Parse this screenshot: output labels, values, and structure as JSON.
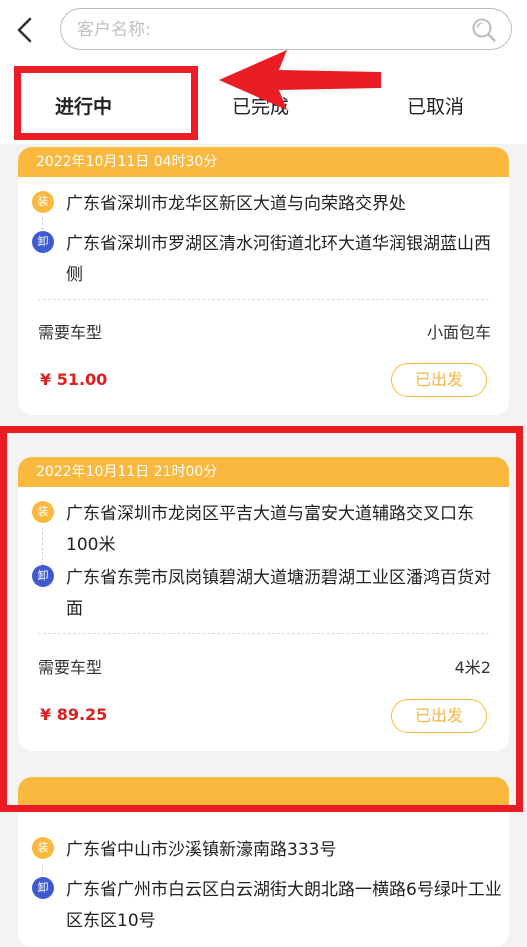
{
  "search": {
    "placeholder": "客户名称:"
  },
  "tabs": [
    {
      "label": "进行中"
    },
    {
      "label": "已完成"
    },
    {
      "label": "已取消"
    }
  ],
  "orders": [
    {
      "datetime": "2022年10月11日  04时30分",
      "load_badge": "装",
      "load_address": "广东省深圳市龙华区新区大道与向荣路交界处",
      "unload_badge": "卸",
      "unload_address": "广东省深圳市罗湖区清水河街道北环大道华润银湖蓝山西侧",
      "vehicle_label": "需要车型",
      "vehicle_type": "小面包车",
      "price": "¥ 51.00",
      "status": "已出发"
    },
    {
      "datetime": "2022年10月11日  21时00分",
      "load_badge": "装",
      "load_address": "广东省深圳市龙岗区平吉大道与富安大道辅路交叉口东100米",
      "unload_badge": "卸",
      "unload_address": "广东省东莞市凤岗镇碧湖大道塘沥碧湖工业区潘鸿百货对面",
      "vehicle_label": "需要车型",
      "vehicle_type": "4米2",
      "price": "¥ 89.25",
      "status": "已出发"
    },
    {
      "datetime": "",
      "load_badge": "装",
      "load_address": "广东省中山市沙溪镇新濠南路333号",
      "unload_badge": "卸",
      "unload_address": "广东省广州市白云区白云湖街大朗北路一横路6号绿叶工业区东区10号"
    }
  ],
  "colors": {
    "accent": "#fbb83e",
    "price": "#e02020",
    "unload_badge": "#3f5bcf",
    "annotation": "#ea1c24"
  }
}
